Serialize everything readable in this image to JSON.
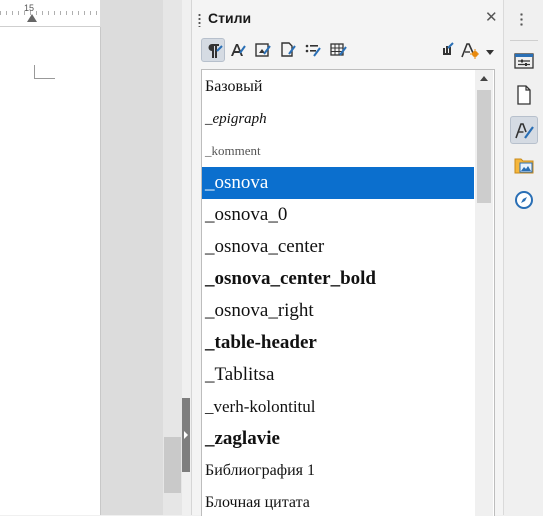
{
  "document": {
    "ruler_number": "15"
  },
  "styles_panel": {
    "title": "Стили",
    "close_glyph": "✕",
    "toolbar": {
      "buttons": [
        {
          "icon": "paragraph-styles-icon",
          "active": true
        },
        {
          "icon": "character-styles-icon",
          "active": false
        },
        {
          "icon": "frame-styles-icon",
          "active": false
        },
        {
          "icon": "page-styles-icon",
          "active": false
        },
        {
          "icon": "list-styles-icon",
          "active": false
        },
        {
          "icon": "table-styles-icon",
          "active": false
        },
        {
          "icon": "fill-format-mode-icon",
          "active": false
        },
        {
          "icon": "new-style-menu-icon",
          "active": false
        }
      ]
    },
    "selected_index": 3,
    "styles": [
      {
        "label": "Базовый",
        "font_size": 16,
        "bold": false,
        "italic": false,
        "color": "#111111"
      },
      {
        "label": "_epigraph",
        "font_size": 15,
        "bold": false,
        "italic": true,
        "color": "#111111"
      },
      {
        "label": "_komment",
        "font_size": 13,
        "bold": false,
        "italic": false,
        "color": "#555555"
      },
      {
        "label": "_osnova",
        "font_size": 19,
        "bold": false,
        "italic": false,
        "color": "#ffffff"
      },
      {
        "label": "_osnova_0",
        "font_size": 19,
        "bold": false,
        "italic": false,
        "color": "#111111"
      },
      {
        "label": "_osnova_center",
        "font_size": 19,
        "bold": false,
        "italic": false,
        "color": "#111111"
      },
      {
        "label": "_osnova_center_bold",
        "font_size": 19,
        "bold": true,
        "italic": false,
        "color": "#111111"
      },
      {
        "label": "_osnova_right",
        "font_size": 19,
        "bold": false,
        "italic": false,
        "color": "#111111"
      },
      {
        "label": "_table-header",
        "font_size": 19,
        "bold": true,
        "italic": false,
        "color": "#111111"
      },
      {
        "label": "_Tablitsa",
        "font_size": 19,
        "bold": false,
        "italic": false,
        "color": "#111111"
      },
      {
        "label": "_verh-kolontitul",
        "font_size": 17,
        "bold": false,
        "italic": false,
        "color": "#111111"
      },
      {
        "label": "_zaglavie",
        "font_size": 19,
        "bold": true,
        "italic": false,
        "color": "#111111"
      },
      {
        "label": "Библиография 1",
        "font_size": 16,
        "bold": false,
        "italic": false,
        "color": "#111111"
      },
      {
        "label": "Блочная цитата",
        "font_size": 16,
        "bold": false,
        "italic": false,
        "color": "#111111"
      }
    ]
  },
  "sidebar": {
    "menu_icon": "vertical-dots-icon",
    "buttons": [
      {
        "icon": "properties-icon",
        "active": false
      },
      {
        "icon": "page-icon",
        "active": false
      },
      {
        "icon": "styles-icon",
        "active": true
      },
      {
        "icon": "gallery-icon",
        "active": false
      },
      {
        "icon": "navigator-icon",
        "active": false
      }
    ]
  },
  "colors": {
    "selection": "#0b6fce",
    "accent_orange": "#e8890c",
    "icon_blue": "#2a6fb5"
  }
}
